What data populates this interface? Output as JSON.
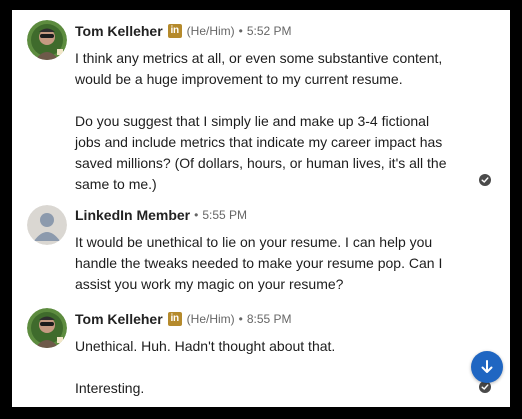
{
  "messages": [
    {
      "sender": "Tom Kelleher",
      "badge": "in",
      "pronouns": "(He/Him)",
      "separator": "•",
      "time": "5:52 PM",
      "paragraphs": [
        "I think any metrics at all, or even some substantive content, would be a huge improvement to my current resume.",
        "Do you suggest that I simply lie and make up 3-4 fictional jobs and include metrics that indicate my career impact has saved millions?  (Of dollars, hours, or human lives, it's all the same to me.)"
      ]
    },
    {
      "sender": "LinkedIn Member",
      "separator": "•",
      "time": "5:55 PM",
      "paragraphs": [
        "It would be unethical to lie on your resume. I can help you handle the tweaks needed to make your resume pop. Can I assist you work my magic on your resume?"
      ]
    },
    {
      "sender": "Tom Kelleher",
      "badge": "in",
      "pronouns": "(He/Him)",
      "separator": "•",
      "time": "8:55 PM",
      "paragraphs": [
        "Unethical. Huh. Hadn't thought about that.",
        "Interesting."
      ]
    }
  ],
  "colors": {
    "accent": "#1f66c2",
    "premium_badge": "#b58a2c",
    "read_receipt": "#4a4a4a"
  },
  "icons": {
    "read_receipt": "check-circle-icon",
    "scroll": "arrow-down-icon"
  }
}
